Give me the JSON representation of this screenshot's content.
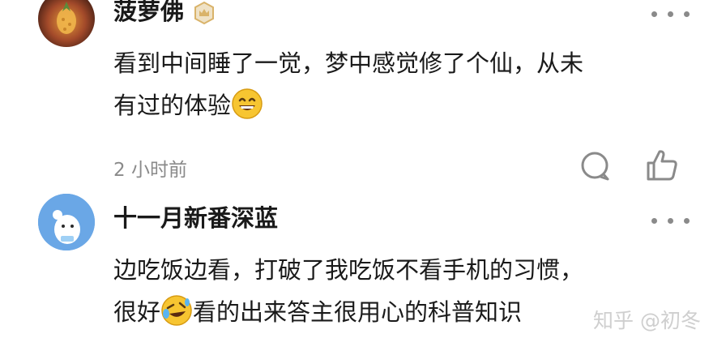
{
  "comments": [
    {
      "author": "菠萝佛",
      "text_line1": "看到中间睡了一觉，梦中感觉修了个仙，从未",
      "text_line2": "有过的体验",
      "emoji": "grinning-face-emoji",
      "time": "2 小时前",
      "badge": "crown-badge-icon"
    },
    {
      "author": "十一月新番深蓝",
      "text_line1": "边吃饭边看，打破了我吃饭不看手机的习惯，",
      "text_line2a": "很好",
      "emoji": "rolling-laughing-emoji",
      "text_line2b": "看的出来答主很用心的科普知识"
    }
  ],
  "watermark": "知乎 @初冬",
  "colors": {
    "text": "#1a1a1a",
    "muted": "#8a8a8a",
    "avatar2_bg": "#6aa7e6",
    "emoji_yellow": "#f7c531",
    "badge_gold": "#d9b36a"
  }
}
